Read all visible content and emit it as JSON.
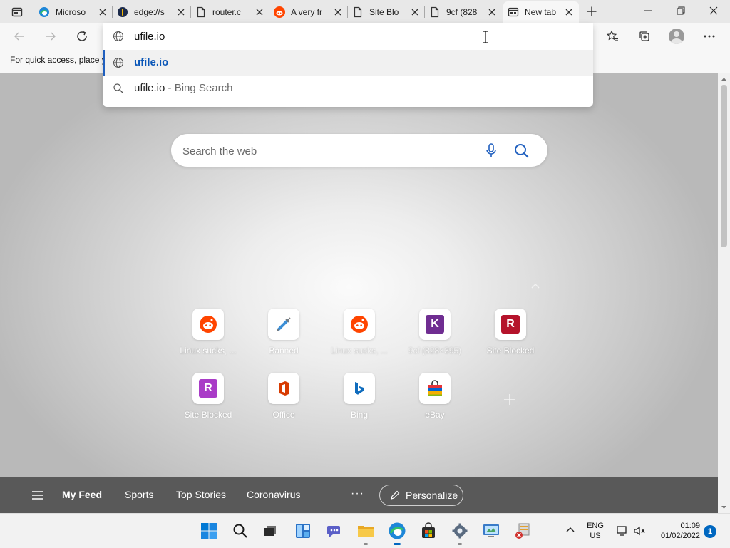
{
  "tabs": [
    {
      "title": "Microso",
      "icon": "edge-icon",
      "active": false
    },
    {
      "title": "edge://s",
      "icon": "edge-settings-icon",
      "active": false
    },
    {
      "title": "router.c",
      "icon": "page-icon",
      "active": false
    },
    {
      "title": "A very fr",
      "icon": "reddit-icon",
      "active": false
    },
    {
      "title": "Site Blo",
      "icon": "page-icon",
      "active": false
    },
    {
      "title": "9cf (828",
      "icon": "page-icon",
      "active": false
    },
    {
      "title": "New tab",
      "icon": "newtab-icon",
      "active": true
    }
  ],
  "omnibox": {
    "value": "ufile.io",
    "suggestions": [
      {
        "text": "ufile.io",
        "suffix": "",
        "icon": "globe-icon"
      },
      {
        "text": "ufile.io",
        "suffix": " - Bing Search",
        "icon": "search-icon"
      }
    ]
  },
  "favorites_bar": {
    "hint": "For quick access, place y"
  },
  "ntp": {
    "search_placeholder": "Search the web",
    "quick_links": [
      {
        "label": "Linux sucks, ...",
        "icon": "reddit-icon",
        "letter": "",
        "color": "#ff4500"
      },
      {
        "label": "Banned",
        "icon": "syringe-icon",
        "letter": "",
        "color": "#3c8fd6"
      },
      {
        "label": "Linux sucks, ...",
        "icon": "reddit-icon",
        "letter": "",
        "color": "#ff4500"
      },
      {
        "label": "9cf (828×395)",
        "icon": "letter-k-icon",
        "letter": "K",
        "color": "#6f2d91"
      },
      {
        "label": "Site Blocked",
        "icon": "letter-r-icon",
        "letter": "R",
        "color": "#b5132b"
      },
      {
        "label": "Site Blocked",
        "icon": "letter-r-icon",
        "letter": "R",
        "color": "#a93bc7"
      },
      {
        "label": "Office",
        "icon": "office-icon",
        "letter": "",
        "color": "#d83b01"
      },
      {
        "label": "Bing",
        "icon": "bing-icon",
        "letter": "",
        "color": "#0f6cbd"
      },
      {
        "label": "eBay",
        "icon": "ebay-bag-icon",
        "letter": "",
        "color": "#e53238"
      }
    ]
  },
  "feed": {
    "tabs": [
      "My Feed",
      "Sports",
      "Top Stories",
      "Coronavirus"
    ],
    "more": "···",
    "personalize": "Personalize"
  },
  "taskbar": {
    "apps": [
      "windows-start-icon",
      "search-icon",
      "task-view-icon",
      "widgets-icon",
      "teams-chat-icon",
      "file-explorer-icon",
      "edge-icon",
      "store-icon",
      "settings-icon",
      "control-panel-icon",
      "network-tool-icon"
    ],
    "lang_line1": "ENG",
    "lang_line2": "US",
    "time": "01:09",
    "date": "01/02/2022",
    "notifications": "1"
  },
  "colors": {
    "accent": "#0067c0",
    "omnibox_highlight": "#0b57b8",
    "feed_bar": "#595959"
  }
}
